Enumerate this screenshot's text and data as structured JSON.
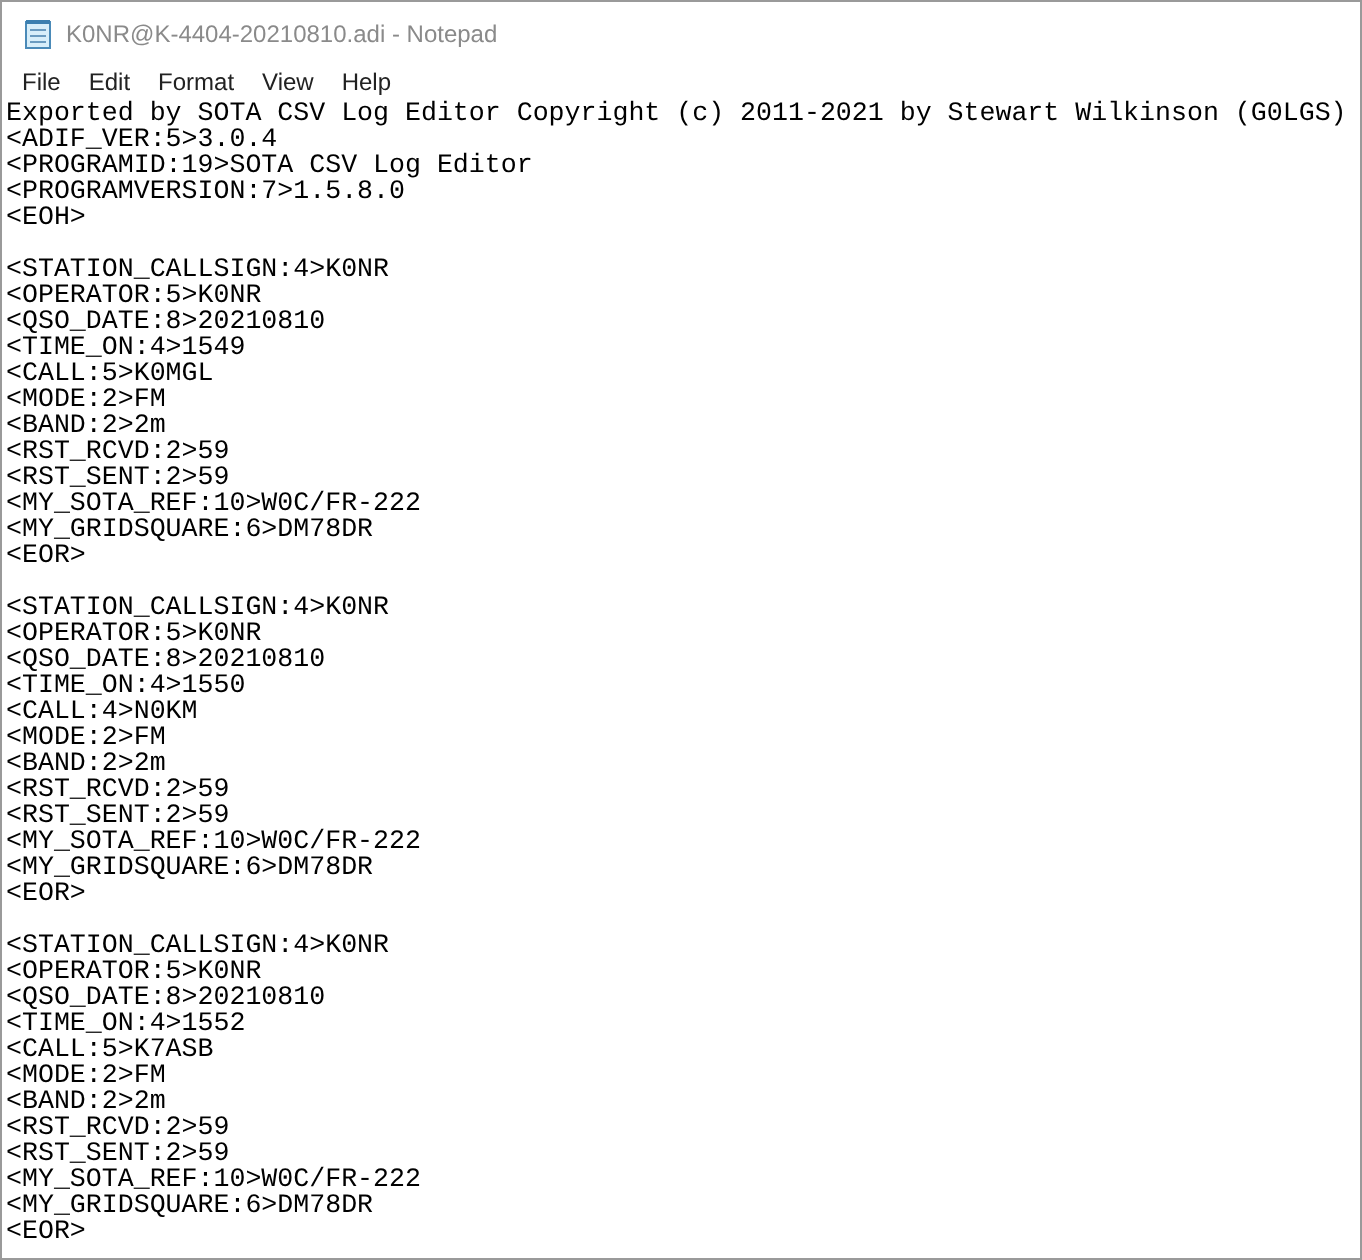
{
  "window": {
    "title": "K0NR@K-4404-20210810.adi - Notepad"
  },
  "menu": [
    "File",
    "Edit",
    "Format",
    "View",
    "Help"
  ],
  "document": {
    "header": [
      "Exported by SOTA CSV Log Editor Copyright (c) 2011-2021 by Stewart Wilkinson (G0LGS)",
      "<ADIF_VER:5>3.0.4",
      "<PROGRAMID:19>SOTA CSV Log Editor",
      "<PROGRAMVERSION:7>1.5.8.0",
      "<EOH>"
    ],
    "records": [
      {
        "lines": [
          "<STATION_CALLSIGN:4>K0NR",
          "<OPERATOR:5>K0NR",
          "<QSO_DATE:8>20210810",
          "<TIME_ON:4>1549",
          "<CALL:5>K0MGL",
          "<MODE:2>FM",
          "<BAND:2>2m",
          "<RST_RCVD:2>59",
          "<RST_SENT:2>59",
          "<MY_SOTA_REF:10>W0C/FR-222",
          "<MY_GRIDSQUARE:6>DM78DR",
          "<EOR>"
        ]
      },
      {
        "lines": [
          "<STATION_CALLSIGN:4>K0NR",
          "<OPERATOR:5>K0NR",
          "<QSO_DATE:8>20210810",
          "<TIME_ON:4>1550",
          "<CALL:4>N0KM",
          "<MODE:2>FM",
          "<BAND:2>2m",
          "<RST_RCVD:2>59",
          "<RST_SENT:2>59",
          "<MY_SOTA_REF:10>W0C/FR-222",
          "<MY_GRIDSQUARE:6>DM78DR",
          "<EOR>"
        ]
      },
      {
        "lines": [
          "<STATION_CALLSIGN:4>K0NR",
          "<OPERATOR:5>K0NR",
          "<QSO_DATE:8>20210810",
          "<TIME_ON:4>1552",
          "<CALL:5>K7ASB",
          "<MODE:2>FM",
          "<BAND:2>2m",
          "<RST_RCVD:2>59",
          "<RST_SENT:2>59",
          "<MY_SOTA_REF:10>W0C/FR-222",
          "<MY_GRIDSQUARE:6>DM78DR",
          "<EOR>"
        ]
      }
    ]
  }
}
